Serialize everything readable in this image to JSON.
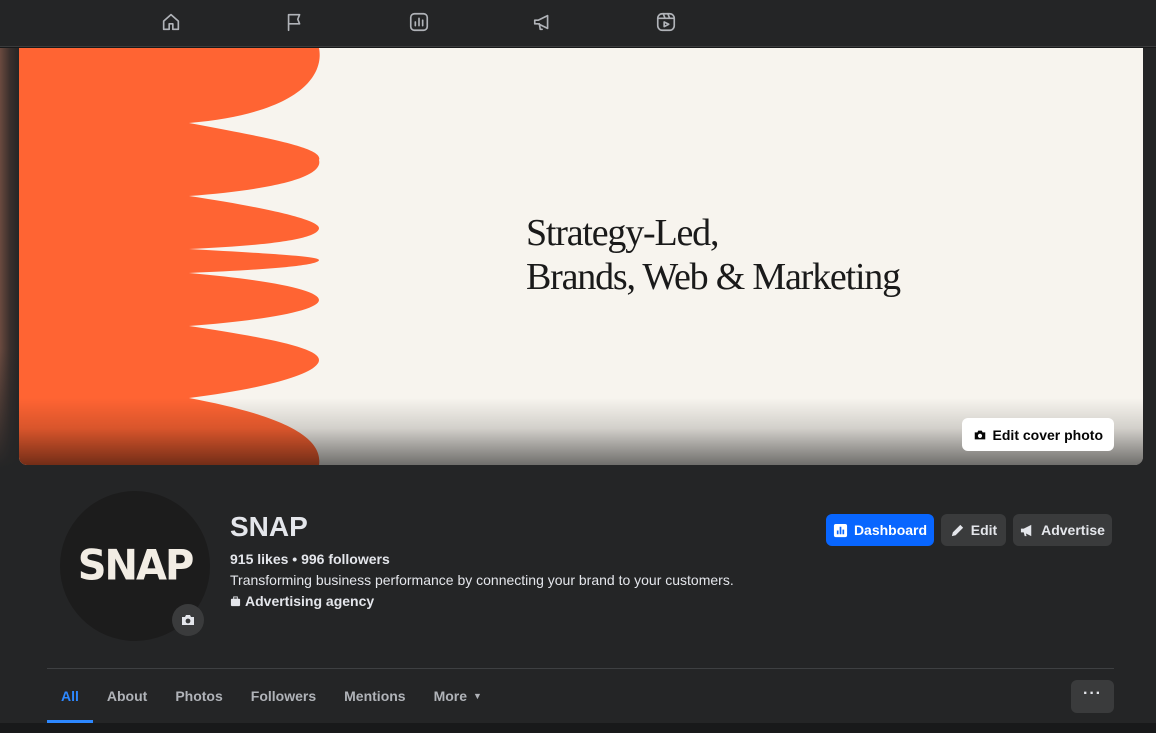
{
  "topnav": {
    "icons": [
      "home-icon",
      "flag-icon",
      "insights-icon",
      "megaphone-icon",
      "reels-icon"
    ]
  },
  "cover": {
    "headline_line1": "Strategy-Led,",
    "headline_line2": "Brands, Web & Marketing",
    "edit_label": "Edit cover photo",
    "accent_color": "#ff6433",
    "background_color": "#f7f4ee"
  },
  "profile": {
    "avatar_text": "SNAP",
    "name": "SNAP",
    "stats": "915 likes • 996 followers",
    "bio": "Transforming business performance by connecting your brand to your customers.",
    "category": "Advertising agency"
  },
  "actions": {
    "dashboard": "Dashboard",
    "edit": "Edit",
    "advertise": "Advertise"
  },
  "tabs": {
    "all": "All",
    "about": "About",
    "photos": "Photos",
    "followers": "Followers",
    "mentions": "Mentions",
    "more": "More",
    "overflow": "···"
  },
  "colors": {
    "primary": "#0866ff",
    "active_tab": "#2d88ff",
    "surface": "#242526"
  }
}
